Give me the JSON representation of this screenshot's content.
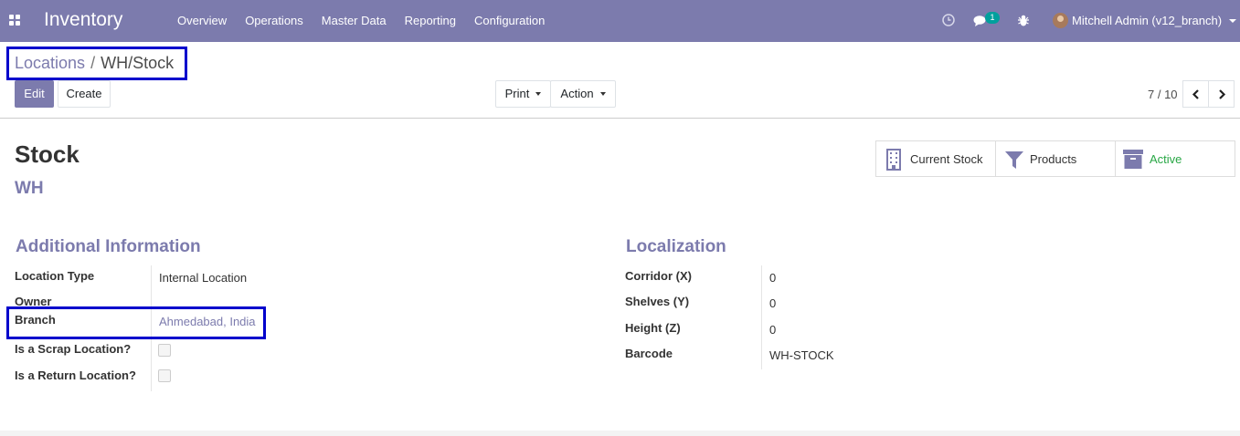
{
  "navbar": {
    "app_name": "Inventory",
    "menu": [
      "Overview",
      "Operations",
      "Master Data",
      "Reporting",
      "Configuration"
    ],
    "chat_badge": "1",
    "user": "Mitchell Admin (v12_branch)",
    "color": "#7c7bad"
  },
  "breadcrumb": {
    "parent": "Locations",
    "separator": "/",
    "current": "WH/Stock"
  },
  "toolbar": {
    "edit": "Edit",
    "create": "Create",
    "print": "Print",
    "action": "Action"
  },
  "pager": {
    "value": "7 / 10"
  },
  "record": {
    "name": "Stock",
    "parent": "WH"
  },
  "smart_buttons": {
    "current_stock": "Current Stock",
    "products": "Products",
    "active": "Active"
  },
  "additional_info": {
    "title": "Additional Information",
    "location_type_label": "Location Type",
    "location_type_value": "Internal Location",
    "owner_label": "Owner",
    "branch_label": "Branch",
    "branch_value": "Ahmedabad, India",
    "scrap_label": "Is a Scrap Location?",
    "return_label": "Is a Return Location?"
  },
  "localization": {
    "title": "Localization",
    "corridor_label": "Corridor (X)",
    "corridor_value": "0",
    "shelves_label": "Shelves (Y)",
    "shelves_value": "0",
    "height_label": "Height (Z)",
    "height_value": "0",
    "barcode_label": "Barcode",
    "barcode_value": "WH-STOCK"
  },
  "colors": {
    "accent": "#7c7bad",
    "active_green": "#28a745",
    "highlight": "#0000cc"
  }
}
